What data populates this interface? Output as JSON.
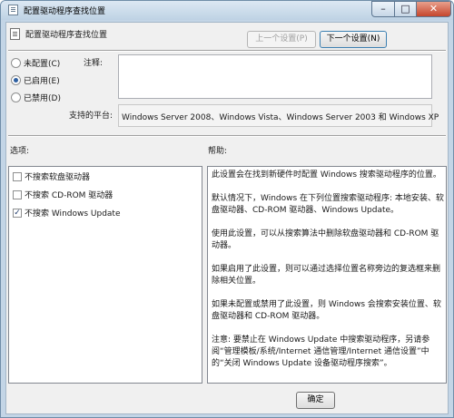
{
  "window": {
    "title": "配置驱动程序查找位置",
    "controls": {
      "minimize": "–",
      "maximize": "□",
      "close": "✕"
    }
  },
  "header": {
    "title": "配置驱动程序查找位置",
    "prev_button": "上一个设置(P)",
    "next_button": "下一个设置(N)"
  },
  "state": {
    "options": [
      {
        "label": "未配置(C)",
        "checked": false
      },
      {
        "label": "已启用(E)",
        "checked": true
      },
      {
        "label": "已禁用(D)",
        "checked": false
      }
    ],
    "comment_label": "注释:",
    "comment_value": "",
    "platform_label": "支持的平台:",
    "platform_value": "Windows Server 2008、Windows Vista、Windows Server 2003 和 Windows XP"
  },
  "options_panel": {
    "label": "选项:",
    "items": [
      {
        "label": "不搜索软盘驱动器",
        "checked": false
      },
      {
        "label": "不搜索 CD-ROM 驱动器",
        "checked": false
      },
      {
        "label": "不搜索 Windows Update",
        "checked": true
      }
    ]
  },
  "help_panel": {
    "label": "帮助:",
    "paragraphs": [
      "此设置会在找到新硬件时配置 Windows 搜索驱动程序的位置。",
      "默认情况下，Windows 在下列位置搜索驱动程序: 本地安装、软盘驱动器、CD-ROM 驱动器、Windows Update。",
      "使用此设置，可以从搜索算法中删除软盘驱动器和 CD-ROM 驱动器。",
      "如果启用了此设置，则可以通过选择位置名称旁边的复选框来删除相关位置。",
      "如果未配置或禁用了此设置，则 Windows 会搜索安装位置、软盘驱动器和 CD-ROM 驱动器。",
      "注意: 要禁止在 Windows Update 中搜索驱动程序，另请参阅“管理模板/系统/Internet 通信管理/Internet 通信设置”中的“关闭 Windows Update 设备驱动程序搜索”。"
    ]
  },
  "footer": {
    "ok_button": "确定"
  }
}
